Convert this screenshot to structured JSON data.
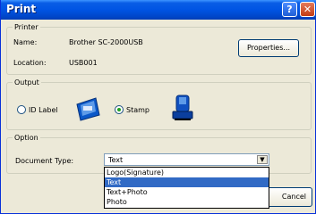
{
  "window": {
    "title": "Print",
    "help_label": "?",
    "close_label": "✕"
  },
  "printer": {
    "group_label": "Printer",
    "name_label": "Name:",
    "name_value": "Brother SC-2000USB",
    "location_label": "Location:",
    "location_value": "USB001",
    "properties_button": "Properties..."
  },
  "output": {
    "group_label": "Output",
    "options": [
      {
        "label": "ID Label",
        "selected": false,
        "icon": "id-label-icon"
      },
      {
        "label": "Stamp",
        "selected": true,
        "icon": "stamp-icon"
      }
    ]
  },
  "option": {
    "group_label": "Option",
    "document_type_label": "Document Type:",
    "document_type_value": "Text",
    "dropdown_items": [
      "Logo(Signature)",
      "Text",
      "Text+Photo",
      "Photo"
    ],
    "selected_index": 1
  },
  "footer": {
    "cancel_partial": "Cancel"
  },
  "colors": {
    "title_bar": "#0054e3",
    "selection": "#316ac5",
    "dialog_bg": "#ece9d8"
  }
}
